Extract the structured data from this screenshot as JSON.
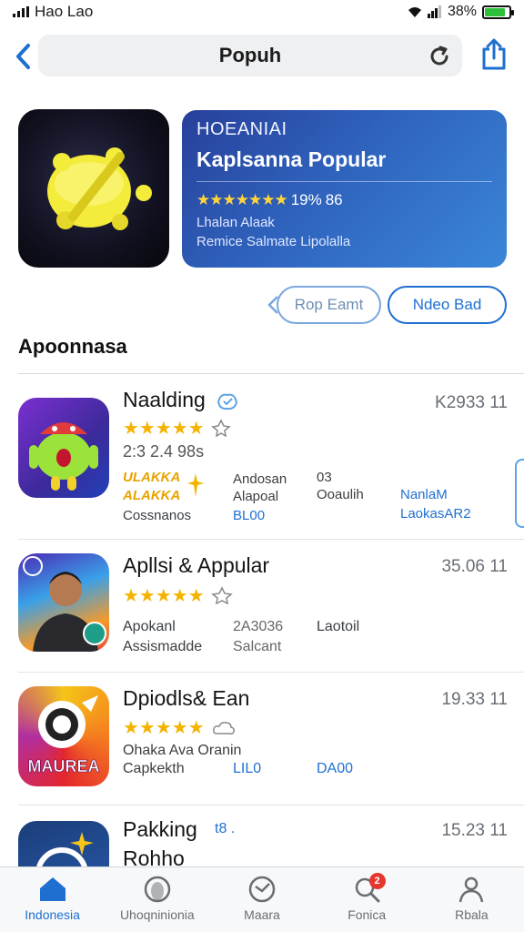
{
  "status": {
    "carrier": "Hao Lao",
    "battery": "38%",
    "battery_level": 0.85
  },
  "nav": {
    "title": "Popuh"
  },
  "feature": {
    "eyebrow": "HOEANIAI",
    "headline": "Kaplsanna Popular",
    "stars": "★★★★★★★",
    "rating_text": "19%",
    "rating_extra": "86",
    "line1": "Lhalan Alaak",
    "line2": "Remice Salmate Lipolalla"
  },
  "buttons": {
    "left": "Rop Eamt",
    "right": "Ndeo Bad"
  },
  "section": {
    "title": "Apoonnasa"
  },
  "list": [
    {
      "name": "Naalding",
      "meta": "K2933 11",
      "stars": "★★★★★",
      "sub": "2:3 2.4 98s",
      "c1a": "Andosan",
      "c1b": "Alapoal",
      "c2a": "03",
      "c2b": "Ooaulih",
      "c3a": "NanlaM",
      "c3b": "LaokasAR2",
      "promo_a": "ULAKKA",
      "promo_b": "ALAKKA",
      "c4a": "Cossnanos",
      "c4b": "BL00"
    },
    {
      "name": "Apllsi & Appular",
      "meta": "35.06 11",
      "stars": "★★★★★",
      "c1a": "Apokanl",
      "c1b": "Assismadde",
      "c2a": "2A3036",
      "c2b": "Salcant",
      "c3a": "Laotoil"
    },
    {
      "name": "Dpiodls& Ean",
      "meta": "19.33 11",
      "stars": "★★★★★",
      "c1a": "Ohaka Ava Oranin",
      "c1b": "Capkekth",
      "c2b": "LIL0",
      "c3b": "DA00",
      "icon_label": "MAUREA"
    },
    {
      "name": "Pakking",
      "name2": "Rohho",
      "meta": "15.23 11",
      "tag": "t8 ."
    }
  ],
  "tabs": [
    {
      "label": "Indonesia",
      "icon": "home-icon"
    },
    {
      "label": "Uhoqninionia",
      "icon": "globe-icon"
    },
    {
      "label": "Maara",
      "icon": "clock-icon"
    },
    {
      "label": "Fonica",
      "icon": "search-icon",
      "badge": "2"
    },
    {
      "label": "Rbala",
      "icon": "person-icon"
    }
  ],
  "colors": {
    "accent": "#1f6fd1",
    "star": "#f5b301",
    "card": "#2f63bd"
  }
}
